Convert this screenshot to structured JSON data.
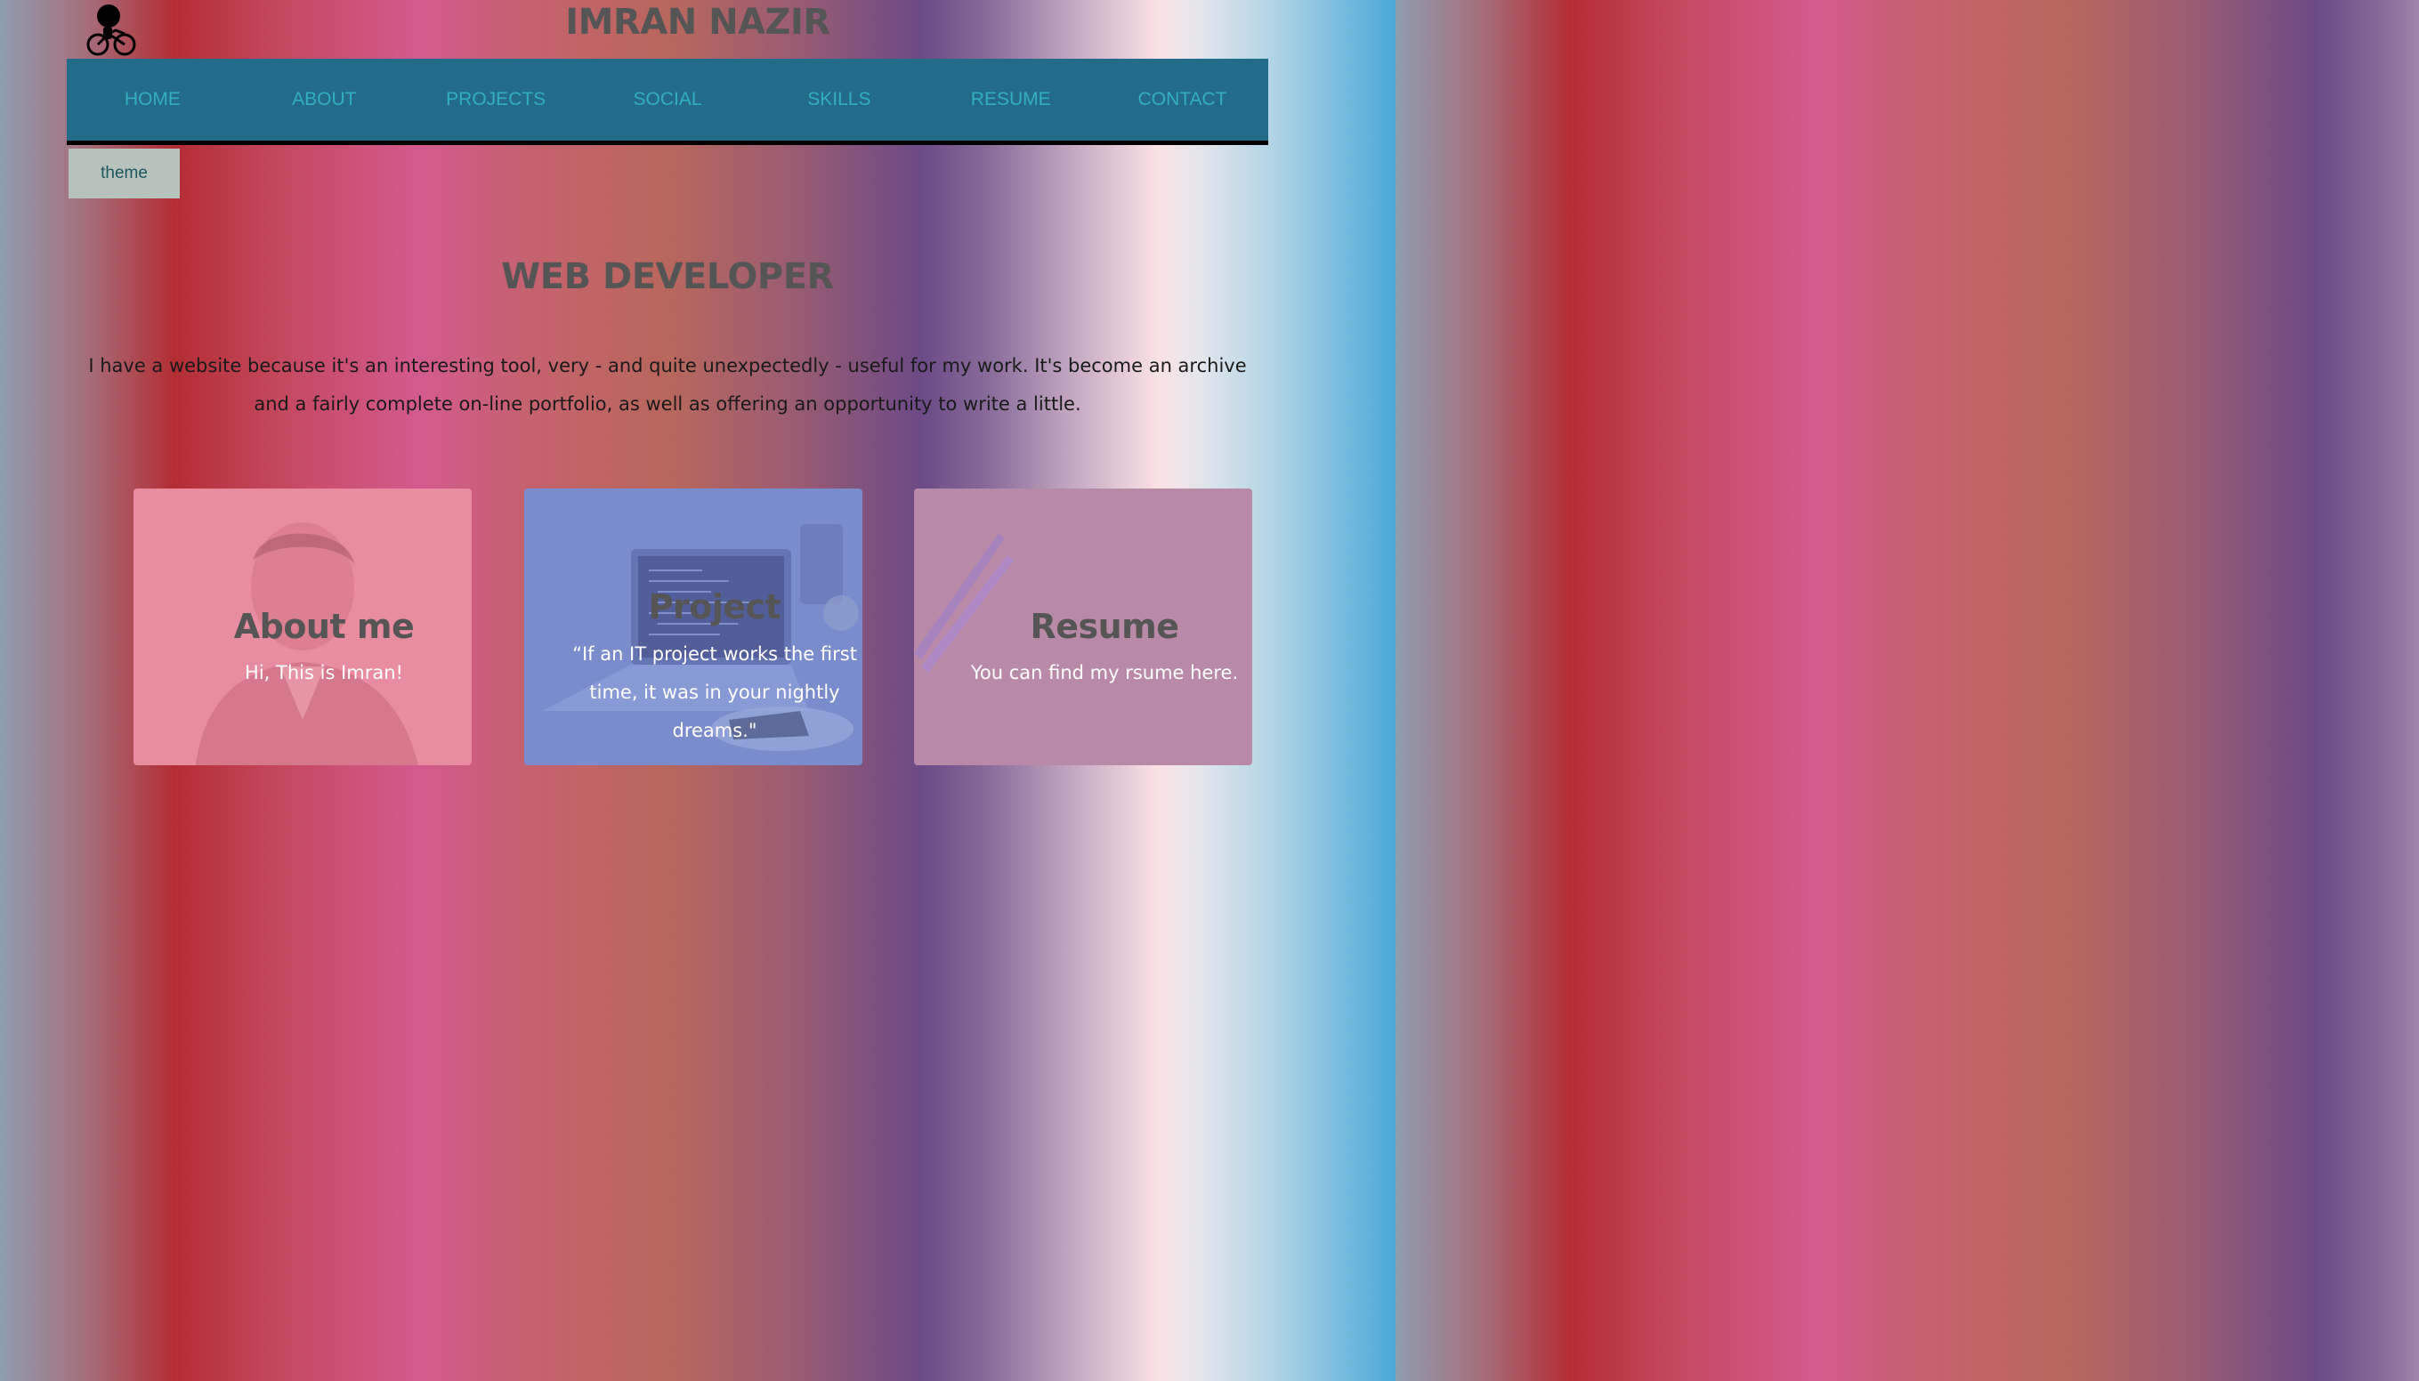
{
  "header": {
    "site_title": "IMRAN NAZIR",
    "logo_icon": "cyclist-icon"
  },
  "nav": {
    "items": [
      {
        "label": "HOME"
      },
      {
        "label": "ABOUT"
      },
      {
        "label": "PROJECTS"
      },
      {
        "label": "SOCIAL"
      },
      {
        "label": "SKILLS"
      },
      {
        "label": "RESUME"
      },
      {
        "label": "CONTACT"
      }
    ]
  },
  "theme_button": {
    "label": "theme"
  },
  "hero": {
    "heading": "WEB DEVELOPER",
    "intro": "I have a website because it's an interesting tool, very - and quite unexpectedly - useful for my work. It's become an archive and a fairly complete on-line portfolio, as well as offering an opportunity to write a little."
  },
  "cards": [
    {
      "title": "About me",
      "text": "Hi, This is Imran!"
    },
    {
      "title": "Project",
      "text": "“If an IT project works the first time, it was in your nightly dreams.\""
    },
    {
      "title": "Resume",
      "text": "You can find my rsume here."
    }
  ],
  "colors": {
    "nav_background": "#236c89",
    "nav_text": "#32aec3",
    "heading_text": "#555555",
    "card_about": "#e88c9f",
    "card_project": "#7a8ccc",
    "card_resume": "#b98aa8"
  }
}
